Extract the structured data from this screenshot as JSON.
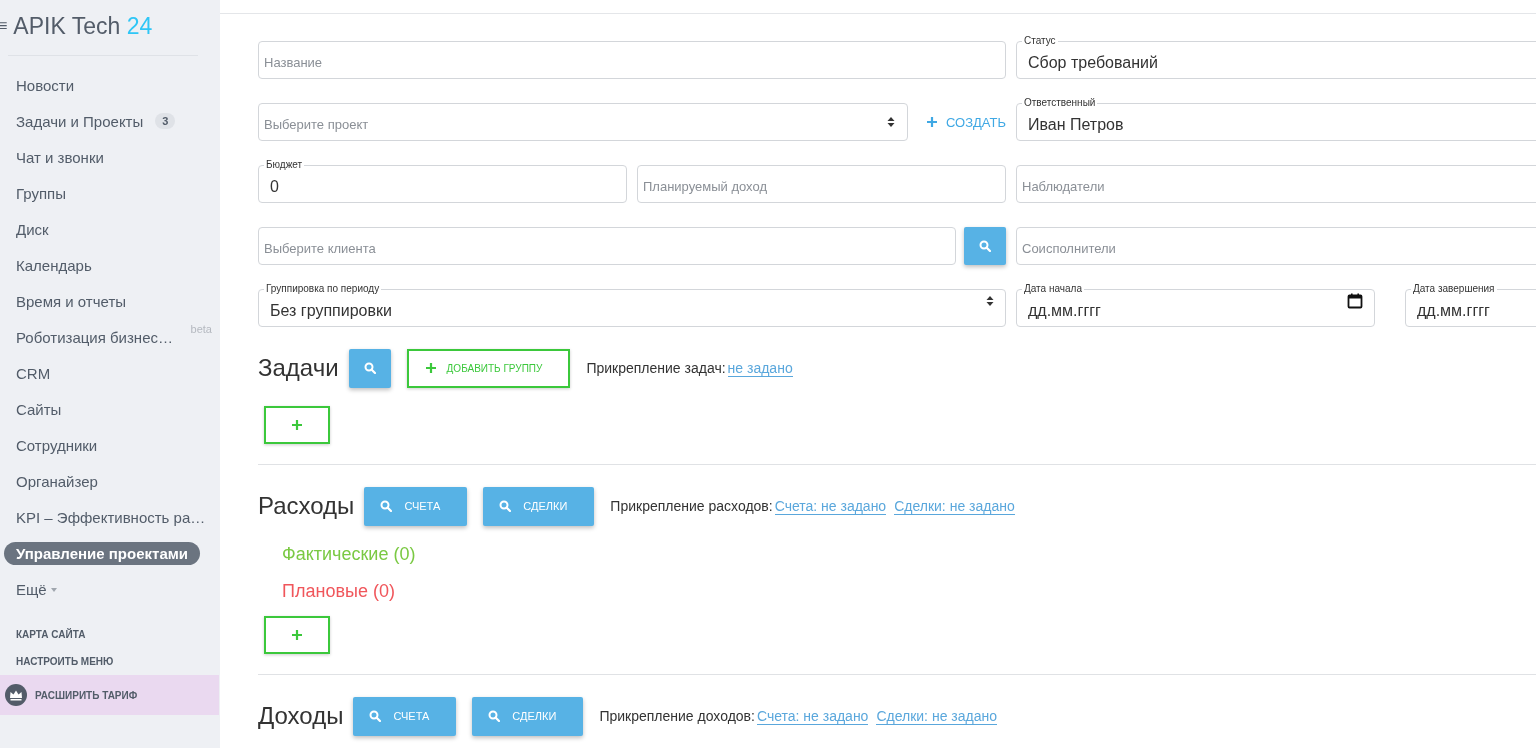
{
  "sidebar": {
    "logo": {
      "menu": "≡",
      "name": "APIK Tech",
      "number": "24"
    },
    "items": [
      {
        "label": "Новости",
        "selected": false
      },
      {
        "label": "Задачи и Проекты",
        "badge": "3",
        "selected": false
      },
      {
        "label": "Чат и звонки",
        "selected": false
      },
      {
        "label": "Группы",
        "selected": false
      },
      {
        "label": "Диск",
        "selected": false
      },
      {
        "label": "Календарь",
        "selected": false
      },
      {
        "label": "Время и отчеты",
        "selected": false
      },
      {
        "label": "Роботизация бизнес…",
        "tag": "beta",
        "selected": false
      },
      {
        "label": "CRM",
        "selected": false
      },
      {
        "label": "Сайты",
        "selected": false
      },
      {
        "label": "Сотрудники",
        "selected": false
      },
      {
        "label": "Органайзер",
        "selected": false
      },
      {
        "label": "KPI – Эффективность ра…",
        "selected": false
      },
      {
        "label": "Управление проектами",
        "selected": true
      },
      {
        "label": "Ещё",
        "dropdown": true,
        "selected": false
      }
    ],
    "links": [
      "КАРТА САЙТА",
      "НАСТРОИТЬ МЕНЮ"
    ],
    "upgrade": "РАСШИРИТЬ ТАРИФ"
  },
  "form": {
    "name": {
      "placeholder": "Название"
    },
    "status": {
      "label": "Статус",
      "value": "Сбор требований"
    },
    "project": {
      "placeholder": "Выберите проект"
    },
    "create": "СОЗДАТЬ",
    "responsible": {
      "label": "Ответственный",
      "value": "Иван Петров"
    },
    "budget": {
      "label": "Бюджет",
      "value": "0"
    },
    "planned_income": {
      "placeholder": "Планируемый доход"
    },
    "observers": {
      "placeholder": "Наблюдатели"
    },
    "client": {
      "placeholder": "Выберите клиента"
    },
    "coexecutors": {
      "placeholder": "Соисполнители"
    },
    "grouping": {
      "label": "Группировка по периоду",
      "value": "Без группировки"
    },
    "date_start": {
      "label": "Дата начала",
      "value": "дд.мм.гггг"
    },
    "date_end": {
      "label": "Дата завершения",
      "value": "дд.мм.гггг"
    }
  },
  "tasks": {
    "title": "Задачи",
    "add_group": "ДОБАВИТЬ ГРУППУ",
    "attach_label": "Прикрепление задач:",
    "attach_links": [
      "не задано"
    ]
  },
  "expenses": {
    "title": "Расходы",
    "buttons": [
      "СЧЕТА",
      "СДЕЛКИ"
    ],
    "attach_label": "Прикрепление расходов:",
    "attach_links": [
      "Счета: не задано",
      "Сделки: не задано"
    ],
    "categories": [
      {
        "label": "Фактические (0)",
        "color": "#7ac943"
      },
      {
        "label": "Плановые (0)",
        "color": "#f0565b"
      }
    ]
  },
  "income": {
    "title": "Доходы",
    "buttons": [
      "СЧЕТА",
      "СДЕЛКИ"
    ],
    "attach_label": "Прикрепление доходов:",
    "attach_links": [
      "Счета: не задано",
      "Сделки: не задано"
    ]
  }
}
